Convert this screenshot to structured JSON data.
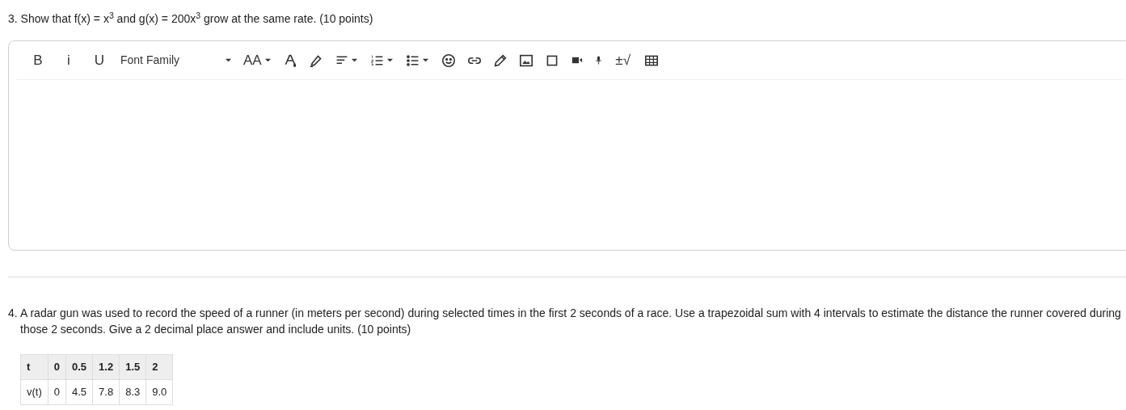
{
  "questions": [
    {
      "number": "3.",
      "text": "Show that f(x) = x$^{3}$ and g(x) = 200x$^{3}$ grow at the same rate. (10 points)"
    },
    {
      "number": "4.",
      "text": "A radar gun was used to record the speed of a runner (in meters per second) during selected times in the first 2 seconds of a race. Use a trapezoidal sum with 4 intervals to estimate the distance the runner covered during those 2 seconds. Give a 2 decimal place answer and include units. (10 points)"
    }
  ],
  "toolbar": [
    {
      "kind": "text",
      "label": "B"
    },
    {
      "kind": "text",
      "label": "i"
    },
    {
      "kind": "text",
      "label": "U"
    },
    {
      "kind": "font",
      "label": "Font Family"
    },
    {
      "kind": "size",
      "label": "AA"
    },
    {
      "kind": "icon"
    },
    {
      "kind": "icon"
    },
    {
      "kind": "dropdown"
    },
    {
      "kind": "dropdown"
    },
    {
      "kind": "dropdown"
    },
    {
      "kind": "icon"
    },
    {
      "kind": "icon"
    },
    {
      "kind": "icon"
    },
    {
      "kind": "icon"
    },
    {
      "kind": "icon"
    },
    {
      "kind": "icon"
    },
    {
      "kind": "icon"
    },
    {
      "kind": "text",
      "label": "±√"
    },
    {
      "kind": "icon"
    }
  ],
  "table": {
    "rows": [
      [
        "t",
        "0",
        "0.5",
        "1.2",
        "1.5",
        "2"
      ],
      [
        "v(t)",
        "0",
        "4.5",
        "7.8",
        "8.3",
        "9.0"
      ]
    ]
  }
}
